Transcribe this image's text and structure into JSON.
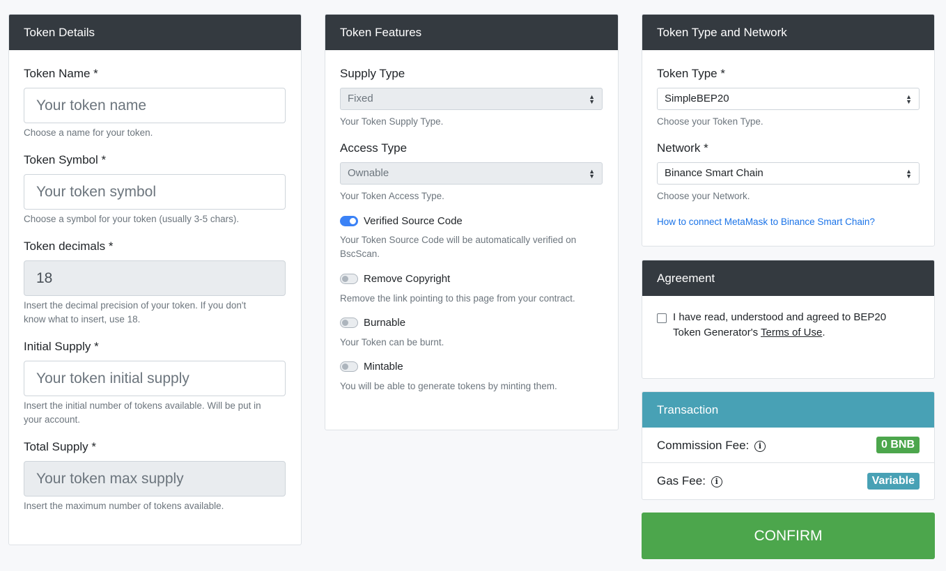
{
  "token_details": {
    "header": "Token Details",
    "name": {
      "label": "Token Name *",
      "placeholder": "Your token name",
      "help": "Choose a name for your token."
    },
    "symbol": {
      "label": "Token Symbol *",
      "placeholder": "Your token symbol",
      "help": "Choose a symbol for your token (usually 3-5 chars)."
    },
    "decimals": {
      "label": "Token decimals *",
      "value": "18",
      "help_line1": "Insert the decimal precision of your token. If you don't",
      "help_line2": "know what to insert, use 18."
    },
    "initial_supply": {
      "label": "Initial Supply *",
      "placeholder": "Your token initial supply",
      "help_line1": "Insert the initial number of tokens available. Will be put in",
      "help_line2": "your account."
    },
    "total_supply": {
      "label": "Total Supply *",
      "placeholder": "Your token max supply",
      "help": "Insert the maximum number of tokens available."
    }
  },
  "token_features": {
    "header": "Token Features",
    "supply_type": {
      "label": "Supply Type",
      "value": "Fixed",
      "help": "Your Token Supply Type."
    },
    "access_type": {
      "label": "Access Type",
      "value": "Ownable",
      "help": "Your Token Access Type."
    },
    "verified": {
      "label": "Verified Source Code",
      "on": true,
      "help_line1": "Your Token Source Code will be automatically verified on",
      "help_line2": "BscScan."
    },
    "copyright": {
      "label": "Remove Copyright",
      "on": false,
      "help": "Remove the link pointing to this page from your contract."
    },
    "burnable": {
      "label": "Burnable",
      "on": false,
      "help": "Your Token can be burnt."
    },
    "mintable": {
      "label": "Mintable",
      "on": false,
      "help": "You will be able to generate tokens by minting them."
    }
  },
  "type_network": {
    "header": "Token Type and Network",
    "token_type": {
      "label": "Token Type *",
      "value": "SimpleBEP20",
      "help": "Choose your Token Type."
    },
    "network": {
      "label": "Network *",
      "value": "Binance Smart Chain",
      "help": "Choose your Network."
    },
    "link": "How to connect MetaMask to Binance Smart Chain?"
  },
  "agreement": {
    "header": "Agreement",
    "text_line1": "I have read, understood and agreed to BEP20",
    "text_line2_prefix": "Token Generator's ",
    "terms_link": "Terms of Use",
    "text_suffix": "."
  },
  "transaction": {
    "header": "Transaction",
    "commission_label": "Commission Fee:",
    "commission_value": "0 BNB",
    "gas_label": "Gas Fee:",
    "gas_value": "Variable",
    "info_glyph": "i"
  },
  "confirm_label": "CONFIRM",
  "colors": {
    "dark_header": "#343a40",
    "info_header": "#48a1b5",
    "success": "#4ca64c",
    "switch_on": "#3b82f6",
    "link": "#1a73e8"
  }
}
